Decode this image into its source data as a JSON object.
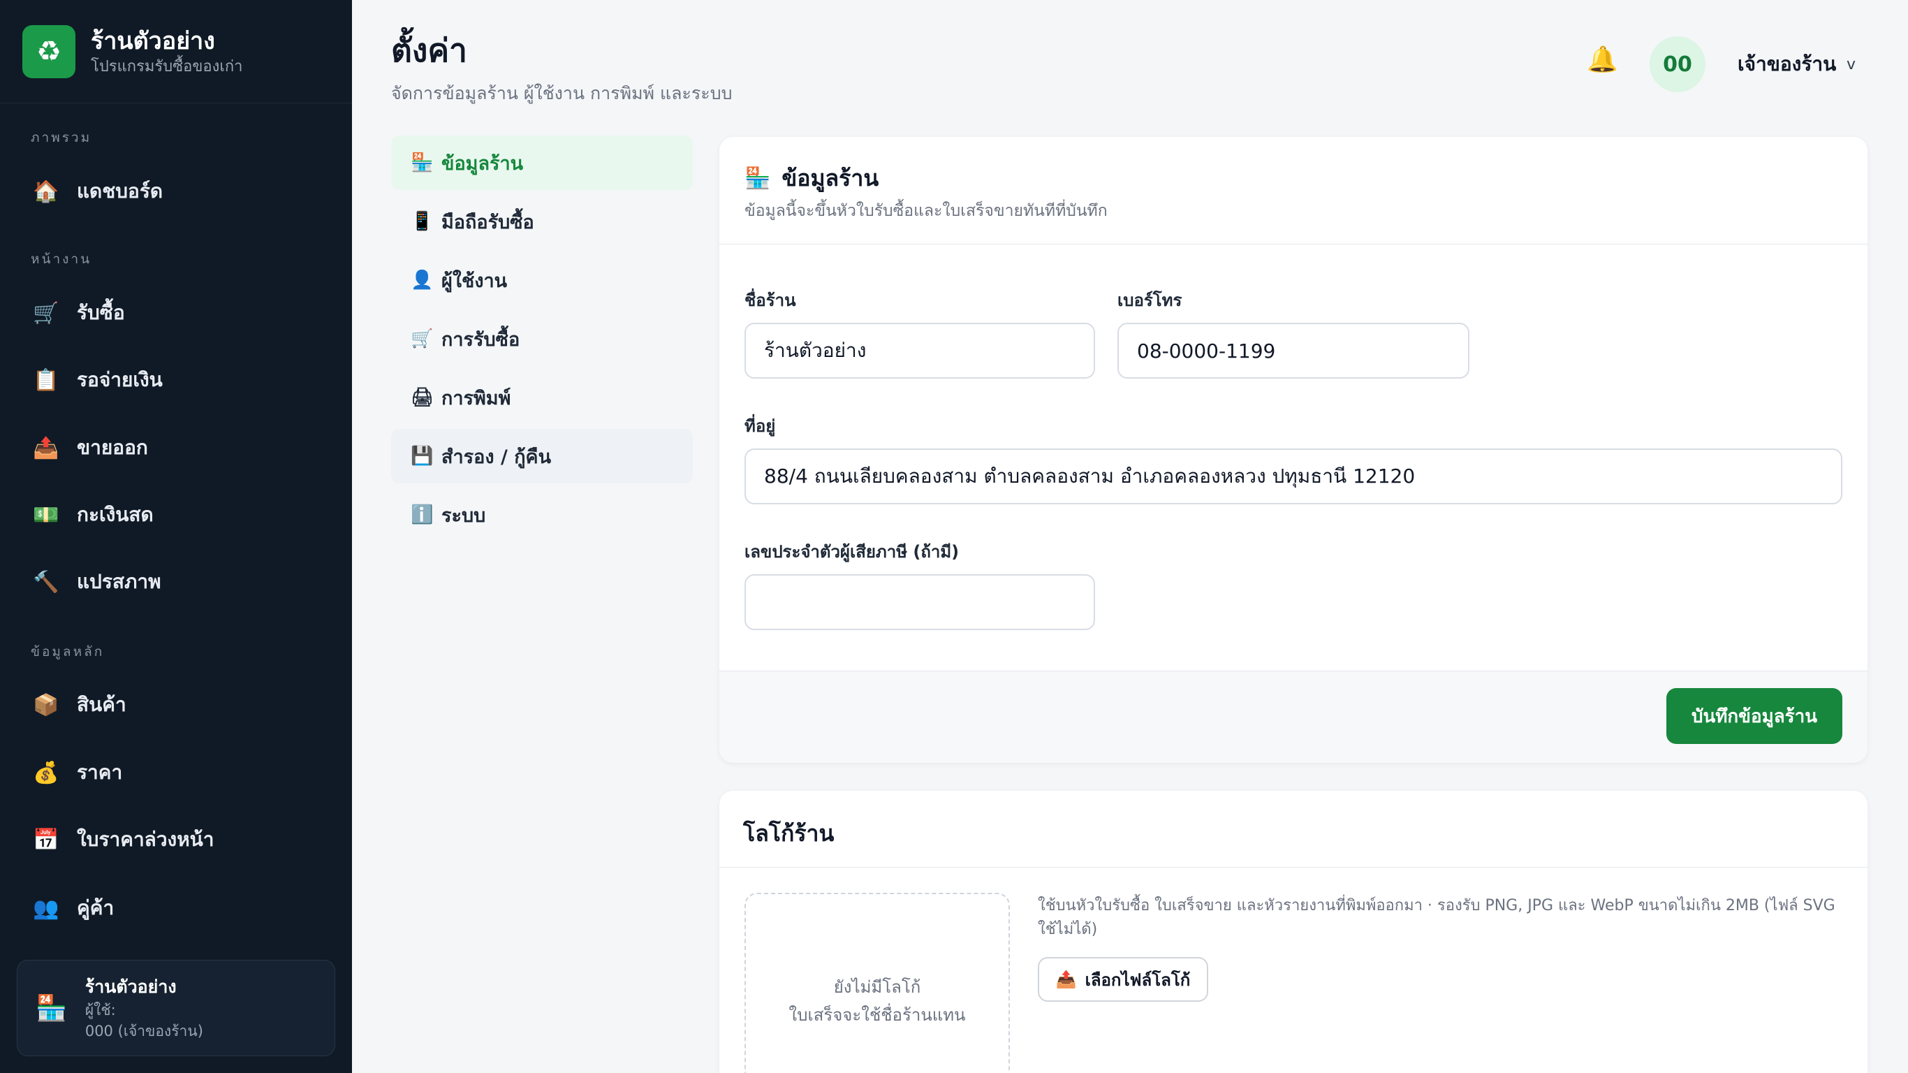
{
  "app": {
    "name": "ร้านตัวอย่าง",
    "subtitle": "โปรแกรมรับซื้อของเก่า"
  },
  "sidebar": {
    "sections": [
      {
        "label": "ภาพรวม"
      },
      {
        "label": "หน้างาน"
      },
      {
        "label": "ข้อมูลหลัก"
      }
    ],
    "items": [
      {
        "label": "แดชบอร์ด",
        "icon": "🏠"
      },
      {
        "label": "รับซื้อ",
        "icon": "🛒"
      },
      {
        "label": "รอจ่ายเงิน",
        "icon": "📋"
      },
      {
        "label": "ขายออก",
        "icon": "📤"
      },
      {
        "label": "กะเงินสด",
        "icon": "💵"
      },
      {
        "label": "แปรสภาพ",
        "icon": "🔨"
      },
      {
        "label": "สินค้า",
        "icon": "📦"
      },
      {
        "label": "ราคา",
        "icon": "💰"
      },
      {
        "label": "ใบราคาล่วงหน้า",
        "icon": "📅"
      },
      {
        "label": "คู่ค้า",
        "icon": "👥"
      }
    ],
    "user_card": {
      "shop": "ร้านตัวอย่าง",
      "user_label": "ผู้ใช้:",
      "user_value": "000 (เจ้าของร้าน)",
      "icon": "🏪"
    }
  },
  "header": {
    "title": "ตั้งค่า",
    "subtitle": "จัดการข้อมูลร้าน ผู้ใช้งาน การพิมพ์ และระบบ",
    "bell_icon": "🔔",
    "avatar_text": "00",
    "role": "เจ้าของร้าน",
    "role_chevron": "v"
  },
  "tabs": [
    {
      "label": "ข้อมูลร้าน",
      "icon": "🏪",
      "active": true
    },
    {
      "label": "มือถือรับซื้อ",
      "icon": "📱"
    },
    {
      "label": "ผู้ใช้งาน",
      "icon": "👤"
    },
    {
      "label": "การรับซื้อ",
      "icon": "🛒"
    },
    {
      "label": "การพิมพ์",
      "icon": "🖨"
    },
    {
      "label": "สำรอง / กู้คืน",
      "icon": "💾"
    },
    {
      "label": "ระบบ",
      "icon": "ℹ️"
    }
  ],
  "shop_info": {
    "title": "ข้อมูลร้าน",
    "title_icon": "🏪",
    "subtitle": "ข้อมูลนี้จะขึ้นหัวใบรับซื้อและใบเสร็จขายทันทีที่บันทึก",
    "name_label": "ชื่อร้าน",
    "name_value": "ร้านตัวอย่าง",
    "phone_label": "เบอร์โทร",
    "phone_value": "08-0000-1199",
    "address_label": "ที่อยู่",
    "address_value": "88/4 ถนนเลียบคลองสาม ตำบลคลองสาม อำเภอคลองหลวง ปทุมธานี 12120",
    "taxid_label": "เลขประจำตัวผู้เสียภาษี (ถ้ามี)",
    "taxid_value": "",
    "save_label": "บันทึกข้อมูลร้าน"
  },
  "logo": {
    "title": "โลโก้ร้าน",
    "empty_line1": "ยังไม่มีโลโก้",
    "empty_line2": "ใบเสร็จจะใช้ชื่อร้านแทน",
    "help": "ใช้บนหัวใบรับซื้อ ใบเสร็จขาย และหัวรายงานที่พิมพ์ออกมา · รองรับ PNG, JPG และ WebP ขนาดไม่เกิน 2MB (ไฟล์ SVG ใช้ไม่ได้)",
    "choose_label": "เลือกไฟล์โลโก้",
    "choose_icon": "📤"
  },
  "colors": {
    "sidebar_bg": "#101a26",
    "accent_green": "#16873d",
    "active_tab_bg": "#e9f8ee"
  }
}
